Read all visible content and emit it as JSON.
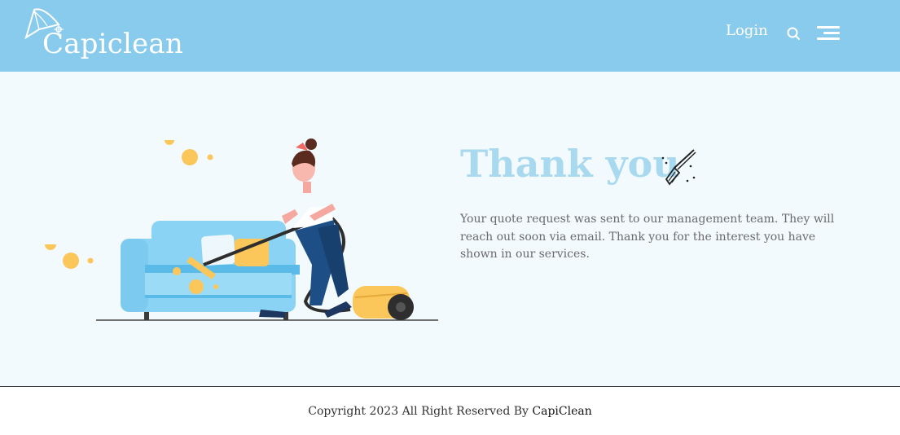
{
  "header": {
    "logo_text": "Capiclean",
    "login_label": "Login",
    "background": "#89cbec",
    "icons": [
      "search-icon",
      "hamburger-menu-icon"
    ]
  },
  "main": {
    "headline": "Thank you",
    "headline_color": "#a8d9ef",
    "message": "Your quote request was sent to our management team. They will reach out soon via email. Thank you for the interest you have shown in our services.",
    "illustration": "woman-vacuuming-sofa-illustration",
    "icons": [
      "broom-icon"
    ]
  },
  "footer": {
    "copyright_prefix": "Copyright 2023 All Right Reserved By",
    "brand_link": "CapiClean"
  }
}
